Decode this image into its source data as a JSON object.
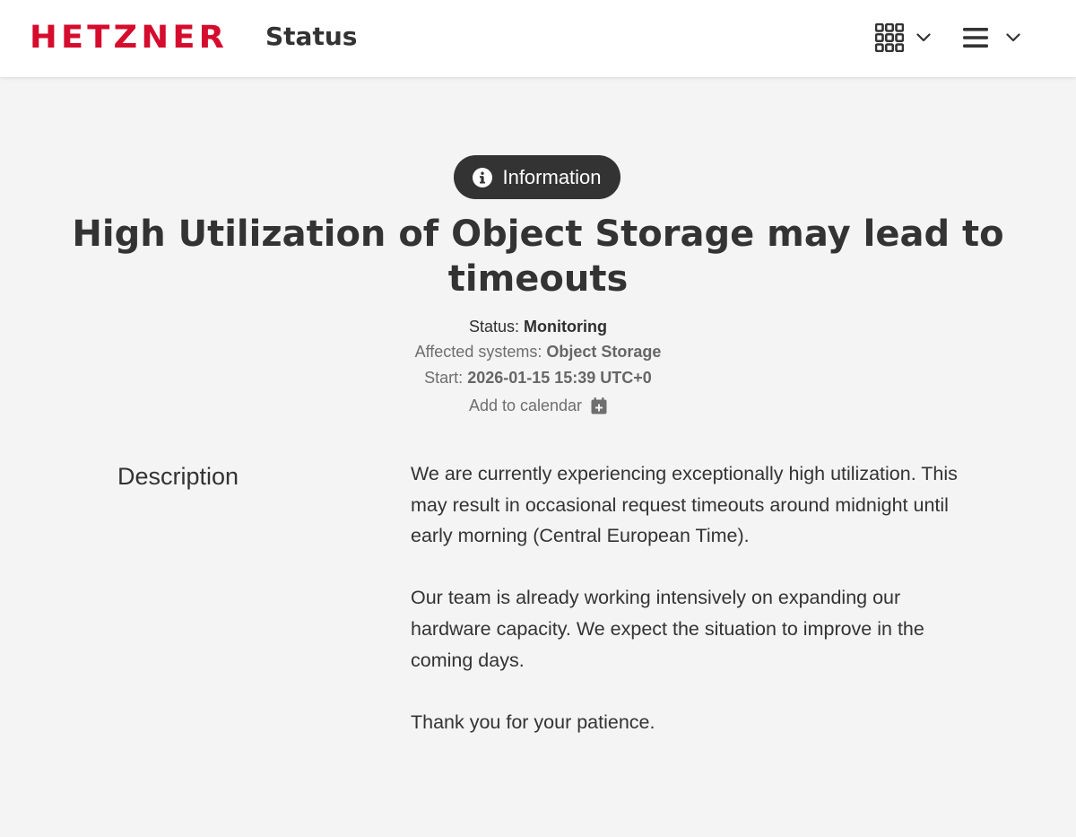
{
  "header": {
    "logo_text": "HETZNER",
    "logo_sub": "Status",
    "brand_color": "#d50c2d",
    "apps_icon": "grid-icon",
    "menu_icon": "hamburger-icon"
  },
  "badge": {
    "icon": "info-circle-icon",
    "label": "Information"
  },
  "incident": {
    "title": "High Utilization of Object Storage may lead to timeouts",
    "status_label": "Status:",
    "status_value": "Monitoring",
    "affected_label": "Affected systems:",
    "affected_value": "Object Storage",
    "start_label": "Start:",
    "start_value": "2026-01-15 15:39 UTC+0",
    "calendar_label": "Add to calendar",
    "calendar_icon": "calendar-plus-icon"
  },
  "description": {
    "heading": "Description",
    "paragraphs": [
      "We are currently experiencing exceptionally high utilization. This may result in occasional request timeouts around midnight until early morning (Central European Time).",
      "Our team is already working intensively on expanding our hardware capacity. We expect the situation to improve in the coming days.",
      "Thank you for your patience."
    ]
  }
}
